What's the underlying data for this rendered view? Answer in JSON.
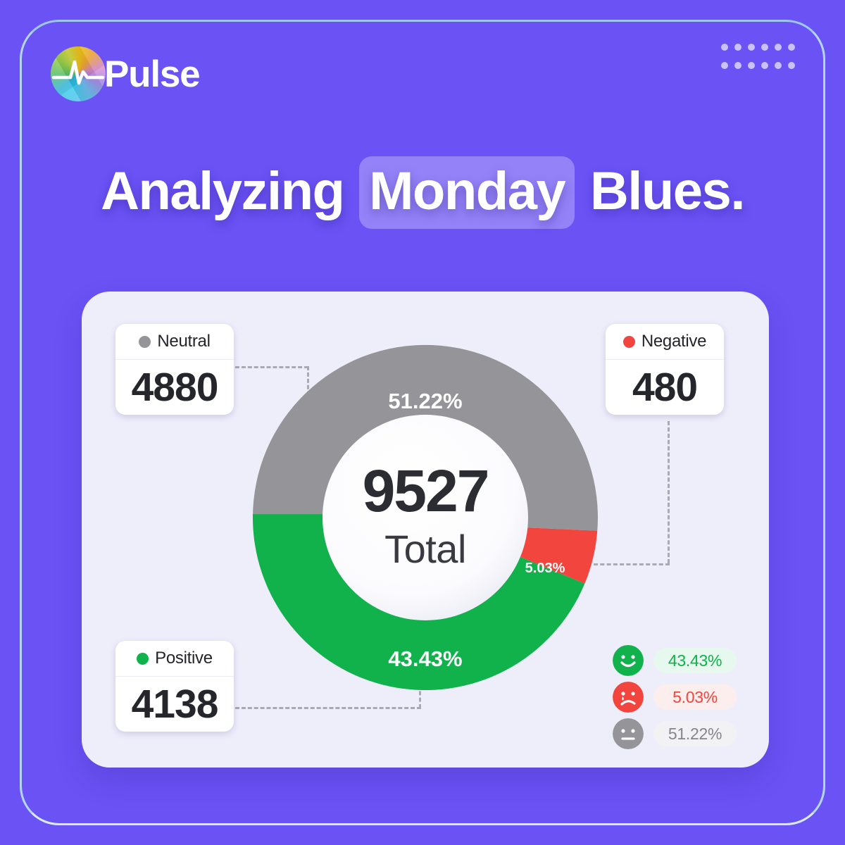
{
  "brand": {
    "name": "Pulse",
    "mark_icon": "pulse-wave-icon"
  },
  "headline": {
    "before": "Analyzing",
    "highlight": "Monday",
    "after": "Blues."
  },
  "colors": {
    "background": "#6a52f5",
    "panel": "#eeeefb",
    "positive": "#11b14b",
    "negative": "#f2453d",
    "neutral": "#949499",
    "frame": "#9cc8f0"
  },
  "stats": [
    {
      "key": "neutral",
      "label": "Neutral",
      "value": "4880",
      "dot_color": "#949499"
    },
    {
      "key": "negative",
      "label": "Negative",
      "value": "480",
      "dot_color": "#f2453d"
    },
    {
      "key": "positive",
      "label": "Positive",
      "value": "4138",
      "dot_color": "#11b14b"
    }
  ],
  "donut": {
    "total_value": "9527",
    "total_label": "Total",
    "labels": {
      "neutral": "51.22%",
      "negative": "5.03%",
      "positive": "43.43%"
    }
  },
  "mood_legend": [
    {
      "face": "smiling-face-icon",
      "value": "43.43%",
      "color": "#11b14b",
      "pill_bg": "#e7f8ee"
    },
    {
      "face": "crying-face-icon",
      "value": "5.03%",
      "color": "#f2453d",
      "pill_bg": "#fdeeee"
    },
    {
      "face": "neutral-face-icon",
      "value": "51.22%",
      "color": "#85858c",
      "pill_bg": "#f2f2f4"
    }
  ],
  "chart_data": {
    "type": "pie",
    "title": "Analyzing Monday Blues.",
    "subtitle": "9527 Total",
    "categories": [
      "Neutral",
      "Positive",
      "Negative"
    ],
    "values": [
      4880,
      4138,
      480
    ],
    "percentages": [
      51.22,
      43.43,
      5.03
    ],
    "colors": [
      "#949499",
      "#11b14b",
      "#f2453d"
    ],
    "total": 9527,
    "legend_position": "cards-around-chart",
    "donut": true,
    "inner_radius_ratio": 0.62,
    "start_angle_deg": -180,
    "direction": "clockwise",
    "xlabel": "",
    "ylabel": ""
  }
}
